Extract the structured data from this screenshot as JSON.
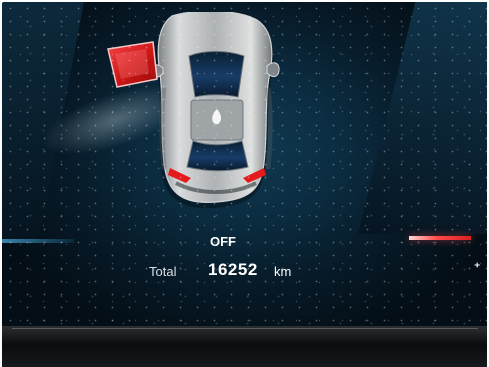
{
  "cluster": {
    "status": "OFF",
    "odometer_label": "Total",
    "odometer_value": "16252",
    "odometer_unit": "km",
    "right_indicator": "⁺"
  },
  "icons": {
    "vehicle": "car-top-view-icon",
    "door_alert": "open-door-icon",
    "right_alert": "red-warning-bar"
  },
  "colors": {
    "screen_background": "#071a28",
    "alert_red": "#ff2b2b",
    "car_silver": "#b9bdc0",
    "glass_blue": "#0e2d56",
    "text_white": "#ffffff"
  }
}
